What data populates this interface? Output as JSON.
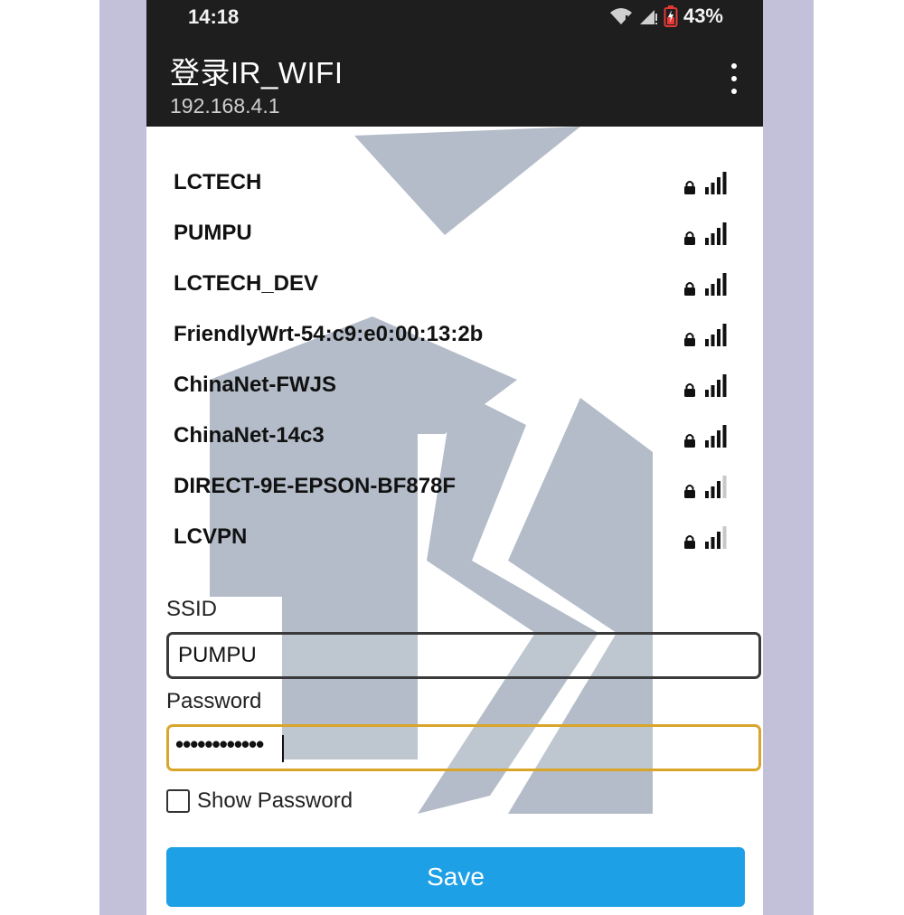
{
  "status_bar": {
    "time": "14:18",
    "battery": "43%"
  },
  "app_bar": {
    "title": "登录IR_WIFI",
    "subtitle": "192.168.4.1",
    "more_icon": "more-vert-icon"
  },
  "networks": [
    {
      "ssid": "LCTECH",
      "locked": true,
      "signal_bars": 4
    },
    {
      "ssid": "PUMPU",
      "locked": true,
      "signal_bars": 4
    },
    {
      "ssid": "LCTECH_DEV",
      "locked": true,
      "signal_bars": 4
    },
    {
      "ssid": "FriendlyWrt-54:c9:e0:00:13:2b",
      "locked": true,
      "signal_bars": 4
    },
    {
      "ssid": "ChinaNet-FWJS",
      "locked": true,
      "signal_bars": 4
    },
    {
      "ssid": "ChinaNet-14c3",
      "locked": true,
      "signal_bars": 4
    },
    {
      "ssid": "DIRECT-9E-EPSON-BF878F",
      "locked": true,
      "signal_bars": 3
    },
    {
      "ssid": "LCVPN",
      "locked": true,
      "signal_bars": 3
    }
  ],
  "form": {
    "ssid_label": "SSID",
    "ssid_value": "PUMPU",
    "password_label": "Password",
    "password_masked": "••••••••••••",
    "show_password_label": "Show Password",
    "save_label": "Save"
  },
  "colors": {
    "app_bar": "#1e1e1e",
    "save_button": "#1ea0e6",
    "focused_border": "#d9a62a",
    "side_background": "#c3c1d9"
  }
}
